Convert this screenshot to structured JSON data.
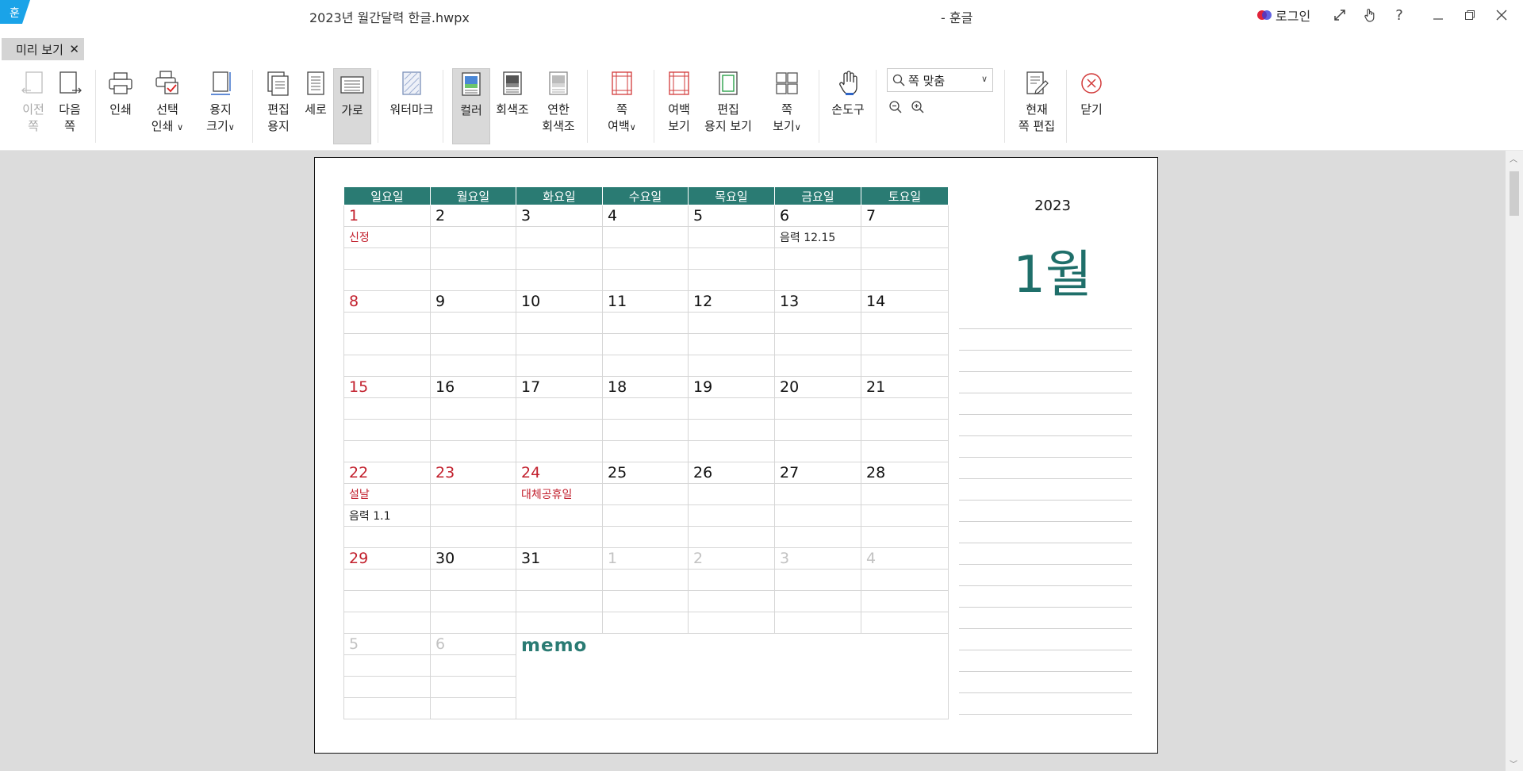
{
  "window": {
    "doc_title": "2023년 월간달력 한글.hwpx",
    "app_name": "- 훈글",
    "logo_char": "훈",
    "login_label": "로그인",
    "help_label": "?"
  },
  "tabs": [
    {
      "label": "미리 보기",
      "close": "✕"
    }
  ],
  "ribbon": {
    "prev_page": [
      "이전",
      "쪽"
    ],
    "next_page": [
      "다음",
      "쪽"
    ],
    "print": "인쇄",
    "select_print": [
      "선택",
      "인쇄"
    ],
    "paper_size": [
      "용지",
      "크기"
    ],
    "edit_paper": [
      "편집",
      "용지"
    ],
    "portrait": "세로",
    "landscape": "가로",
    "watermark": "워터마크",
    "color": "컬러",
    "grayscale": "회색조",
    "light_grayscale": [
      "연한",
      "회색조"
    ],
    "page_margin": [
      "쪽",
      "여백"
    ],
    "margin_view": [
      "여백",
      "보기"
    ],
    "edit_paper_view": [
      "편집",
      "용지 보기"
    ],
    "page_view": [
      "쪽",
      "보기"
    ],
    "hand_tool": "손도구",
    "zoom_value": "쪽 맞춤",
    "current_page_edit": [
      "현재",
      "쪽 편집"
    ],
    "close": "닫기"
  },
  "calendar": {
    "weekdays": [
      "일요일",
      "월요일",
      "화요일",
      "수요일",
      "목요일",
      "금요일",
      "토요일"
    ],
    "weeks": [
      {
        "days": [
          "1",
          "2",
          "3",
          "4",
          "5",
          "6",
          "7"
        ],
        "notes1": [
          "신정",
          "",
          "",
          "",
          "",
          "음력  12.15",
          ""
        ],
        "notes2": [
          "",
          "",
          "",
          "",
          "",
          "",
          ""
        ]
      },
      {
        "days": [
          "8",
          "9",
          "10",
          "11",
          "12",
          "13",
          "14"
        ],
        "notes1": [
          "",
          "",
          "",
          "",
          "",
          "",
          ""
        ],
        "notes2": [
          "",
          "",
          "",
          "",
          "",
          "",
          ""
        ]
      },
      {
        "days": [
          "15",
          "16",
          "17",
          "18",
          "19",
          "20",
          "21"
        ],
        "notes1": [
          "",
          "",
          "",
          "",
          "",
          "",
          ""
        ],
        "notes2": [
          "",
          "",
          "",
          "",
          "",
          "",
          ""
        ]
      },
      {
        "days": [
          "22",
          "23",
          "24",
          "25",
          "26",
          "27",
          "28"
        ],
        "notes1": [
          "설날",
          "",
          "대체공휴일",
          "",
          "",
          "",
          ""
        ],
        "notes2": [
          "음력  1.1",
          "",
          "",
          "",
          "",
          "",
          ""
        ]
      },
      {
        "days": [
          "29",
          "30",
          "31",
          "1",
          "2",
          "3",
          "4"
        ],
        "notes1": [
          "",
          "",
          "",
          "",
          "",
          "",
          ""
        ],
        "notes2": [
          "",
          "",
          "",
          "",
          "",
          "",
          ""
        ]
      }
    ],
    "trailing_days": [
      "5",
      "6"
    ],
    "memo_label": "memo",
    "year": "2023",
    "month": "1월"
  },
  "colors": {
    "header_teal": "#2a7b73",
    "holiday_red": "#c21f2c",
    "month_text": "#1f6f6a",
    "other_month_gray": "#c2c2c2"
  }
}
